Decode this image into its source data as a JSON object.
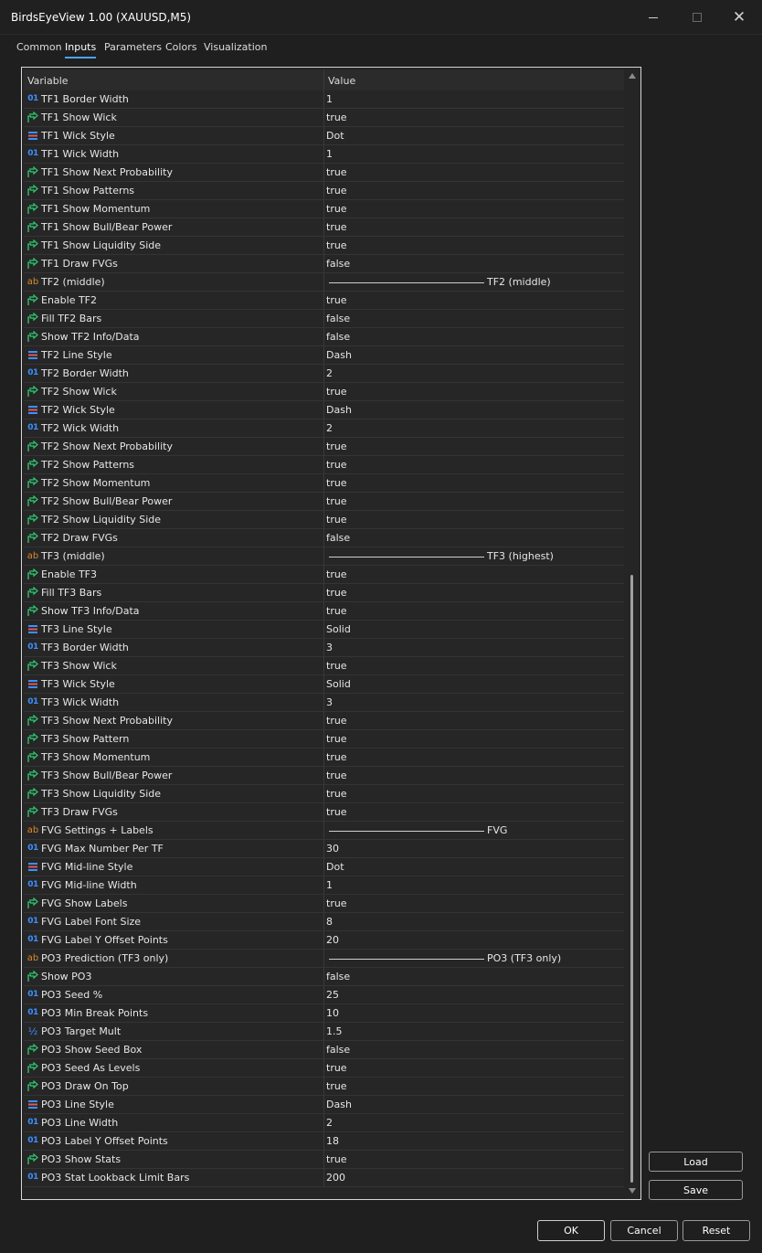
{
  "window": {
    "title": "BirdsEyeView 1.00 (XAUUSD,M5)"
  },
  "tabs": [
    "Common",
    "Inputs",
    "Parameters",
    "Colors",
    "Visualization"
  ],
  "active_tab": "Inputs",
  "grid": {
    "col_variable": "Variable",
    "col_value": "Value",
    "rows": [
      {
        "icon": "int",
        "name": "TF1 Border Width",
        "value": "1"
      },
      {
        "icon": "bool",
        "name": "TF1 Show Wick",
        "value": "true"
      },
      {
        "icon": "enum",
        "name": "TF1 Wick Style",
        "value": "Dot"
      },
      {
        "icon": "int",
        "name": "TF1 Wick Width",
        "value": "1"
      },
      {
        "icon": "bool",
        "name": "TF1 Show Next Probability",
        "value": "true"
      },
      {
        "icon": "bool",
        "name": "TF1 Show Patterns",
        "value": "true"
      },
      {
        "icon": "bool",
        "name": "TF1 Show Momentum",
        "value": "true"
      },
      {
        "icon": "bool",
        "name": "TF1 Show Bull/Bear Power",
        "value": "true"
      },
      {
        "icon": "bool",
        "name": "TF1 Show Liquidity Side",
        "value": "true"
      },
      {
        "icon": "bool",
        "name": "TF1 Draw FVGs",
        "value": "false"
      },
      {
        "icon": "str",
        "name": "TF2 (middle)",
        "value": "TF2 (middle)",
        "section": true
      },
      {
        "icon": "bool",
        "name": "Enable TF2",
        "value": "true"
      },
      {
        "icon": "bool",
        "name": "Fill TF2 Bars",
        "value": "false"
      },
      {
        "icon": "bool",
        "name": "Show TF2 Info/Data",
        "value": "false"
      },
      {
        "icon": "enum",
        "name": "TF2 Line Style",
        "value": "Dash"
      },
      {
        "icon": "int",
        "name": "TF2 Border Width",
        "value": "2"
      },
      {
        "icon": "bool",
        "name": "TF2 Show Wick",
        "value": "true"
      },
      {
        "icon": "enum",
        "name": "TF2 Wick Style",
        "value": "Dash"
      },
      {
        "icon": "int",
        "name": "TF2 Wick Width",
        "value": "2"
      },
      {
        "icon": "bool",
        "name": "TF2 Show Next Probability",
        "value": "true"
      },
      {
        "icon": "bool",
        "name": "TF2 Show Patterns",
        "value": "true"
      },
      {
        "icon": "bool",
        "name": "TF2 Show Momentum",
        "value": "true"
      },
      {
        "icon": "bool",
        "name": "TF2 Show Bull/Bear Power",
        "value": "true"
      },
      {
        "icon": "bool",
        "name": "TF2 Show Liquidity Side",
        "value": "true"
      },
      {
        "icon": "bool",
        "name": "TF2 Draw FVGs",
        "value": "false"
      },
      {
        "icon": "str",
        "name": "TF3 (middle)",
        "value": "TF3 (highest)",
        "section": true
      },
      {
        "icon": "bool",
        "name": "Enable TF3",
        "value": "true"
      },
      {
        "icon": "bool",
        "name": "Fill TF3 Bars",
        "value": "true"
      },
      {
        "icon": "bool",
        "name": "Show TF3 Info/Data",
        "value": "true"
      },
      {
        "icon": "enum",
        "name": "TF3 Line Style",
        "value": "Solid"
      },
      {
        "icon": "int",
        "name": "TF3 Border Width",
        "value": "3"
      },
      {
        "icon": "bool",
        "name": "TF3 Show Wick",
        "value": "true"
      },
      {
        "icon": "enum",
        "name": "TF3 Wick Style",
        "value": "Solid"
      },
      {
        "icon": "int",
        "name": "TF3 Wick Width",
        "value": "3"
      },
      {
        "icon": "bool",
        "name": "TF3 Show Next Probability",
        "value": "true"
      },
      {
        "icon": "bool",
        "name": "TF3 Show Pattern",
        "value": "true"
      },
      {
        "icon": "bool",
        "name": "TF3 Show Momentum",
        "value": "true"
      },
      {
        "icon": "bool",
        "name": "TF3 Show Bull/Bear Power",
        "value": "true"
      },
      {
        "icon": "bool",
        "name": "TF3 Show Liquidity Side",
        "value": "true"
      },
      {
        "icon": "bool",
        "name": "TF3 Draw FVGs",
        "value": "true"
      },
      {
        "icon": "str",
        "name": "FVG Settings + Labels",
        "value": "FVG",
        "section": true
      },
      {
        "icon": "int",
        "name": "FVG Max Number Per TF",
        "value": "30"
      },
      {
        "icon": "enum",
        "name": "FVG Mid-line Style",
        "value": "Dot"
      },
      {
        "icon": "int",
        "name": "FVG Mid-line Width",
        "value": "1"
      },
      {
        "icon": "bool",
        "name": "FVG Show Labels",
        "value": "true"
      },
      {
        "icon": "int",
        "name": "FVG Label Font Size",
        "value": "8"
      },
      {
        "icon": "int",
        "name": "FVG Label Y Offset Points",
        "value": "20"
      },
      {
        "icon": "str",
        "name": "PO3 Prediction (TF3 only)",
        "value": "PO3 (TF3 only)",
        "section": true
      },
      {
        "icon": "bool",
        "name": "Show PO3",
        "value": "false"
      },
      {
        "icon": "int",
        "name": "PO3 Seed %",
        "value": "25"
      },
      {
        "icon": "int",
        "name": "PO3 Min Break Points",
        "value": "10"
      },
      {
        "icon": "dbl",
        "name": "PO3 Target Mult",
        "value": "1.5"
      },
      {
        "icon": "bool",
        "name": "PO3 Show Seed Box",
        "value": "false"
      },
      {
        "icon": "bool",
        "name": "PO3 Seed As Levels",
        "value": "true"
      },
      {
        "icon": "bool",
        "name": "PO3 Draw On Top",
        "value": "true"
      },
      {
        "icon": "enum",
        "name": "PO3 Line Style",
        "value": "Dash"
      },
      {
        "icon": "int",
        "name": "PO3 Line Width",
        "value": "2"
      },
      {
        "icon": "int",
        "name": "PO3 Label Y Offset Points",
        "value": "18"
      },
      {
        "icon": "bool",
        "name": "PO3 Show Stats",
        "value": "true"
      },
      {
        "icon": "int",
        "name": "PO3 Stat Lookback Limit Bars",
        "value": "200"
      }
    ]
  },
  "icon_glyphs": {
    "int": "01",
    "str": "ab",
    "dbl": "½"
  },
  "buttons": {
    "load": "Load",
    "save": "Save",
    "ok": "OK",
    "cancel": "Cancel",
    "reset": "Reset"
  },
  "colors": {
    "accent": "#4aa3ff",
    "int_icon": "#3d8fff",
    "bool_icon": "#2ecc71",
    "str_icon": "#d9892a",
    "enum_icon": "#3d8fff"
  }
}
